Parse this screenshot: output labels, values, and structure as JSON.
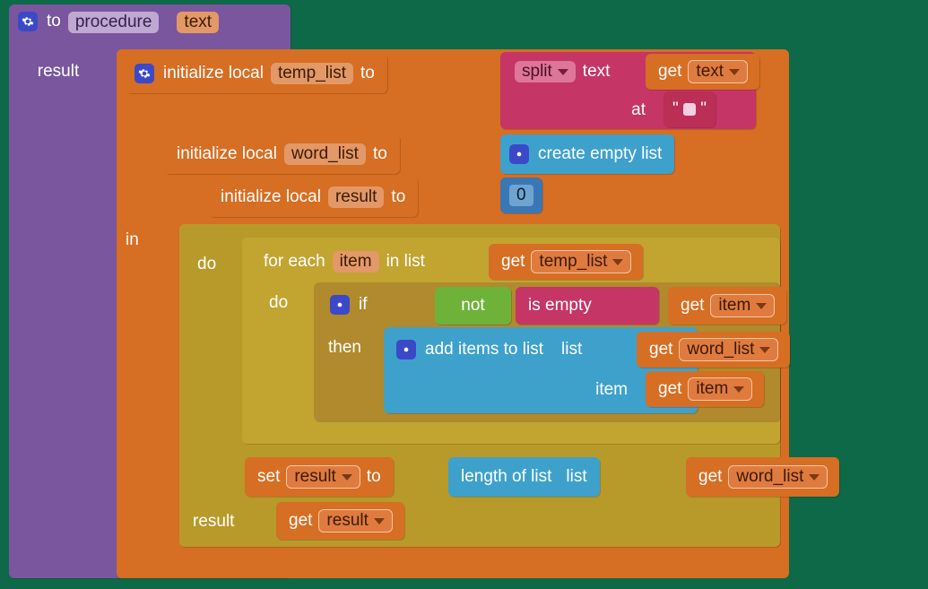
{
  "proc": {
    "to": "to",
    "name": "procedure",
    "param": "text",
    "result": "result"
  },
  "init": {
    "label": "initialize local",
    "to": "to",
    "in": "in",
    "v1": "temp_list",
    "v2": "word_list",
    "v3": "result",
    "zero": "0"
  },
  "split": {
    "label": "split",
    "text_kw": "text",
    "get_kw": "get",
    "var": "text",
    "at_kw": "at",
    "lit": "\""
  },
  "createEmpty": "create empty list",
  "foreach": {
    "forEach": "for each",
    "item": "item",
    "inList": "in list",
    "do": "do"
  },
  "getTemp": {
    "get": "get",
    "var": "temp_list"
  },
  "if": {
    "if": "if",
    "then": "then",
    "not": "not",
    "isEmpty": "is empty"
  },
  "getItem": {
    "get": "get",
    "var": "item"
  },
  "addItems": {
    "label": "add items to list",
    "list": "list",
    "item": "item"
  },
  "getWordList": {
    "get": "get",
    "var": "word_list"
  },
  "set": {
    "set": "set",
    "var": "result",
    "to": "to"
  },
  "lengthOfList": {
    "label": "length of list",
    "list": "list"
  },
  "resultRow": {
    "result": "result",
    "get": "get",
    "var": "result"
  },
  "do": "do"
}
